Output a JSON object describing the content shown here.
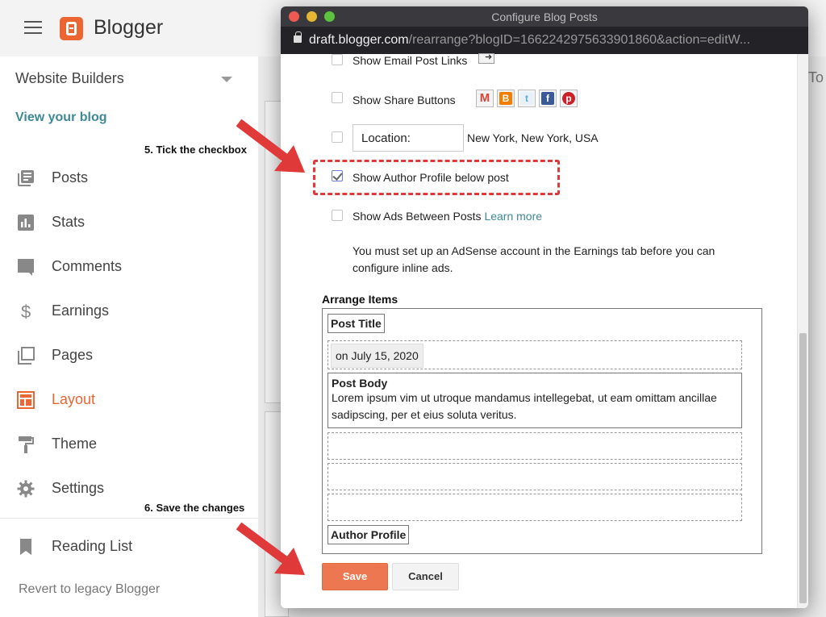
{
  "app": {
    "brand": "Blogger",
    "blog_selector": "Website Builders",
    "view_blog": "View your blog",
    "nav": [
      {
        "label": "Posts",
        "icon": "posts-icon",
        "active": false
      },
      {
        "label": "Stats",
        "icon": "stats-icon",
        "active": false
      },
      {
        "label": "Comments",
        "icon": "comments-icon",
        "active": false
      },
      {
        "label": "Earnings",
        "icon": "dollar-icon",
        "active": false
      },
      {
        "label": "Pages",
        "icon": "pages-icon",
        "active": false
      },
      {
        "label": "Layout",
        "icon": "layout-icon",
        "active": true
      },
      {
        "label": "Theme",
        "icon": "paint-roller-icon",
        "active": false
      },
      {
        "label": "Settings",
        "icon": "gear-icon",
        "active": false
      }
    ],
    "reading_list": "Reading List",
    "revert": "Revert to legacy Blogger",
    "partial_text": "To",
    "accent_color": "#ec6633"
  },
  "annotations": {
    "step5": "5. Tick the checkbox",
    "step6": "6. Save the changes",
    "arrow_color": "#e0393a"
  },
  "modal": {
    "title": "Configure Blog Posts",
    "url_host": "draft.blogger.com",
    "url_path": "/rearrange?blogID=1662242975633901860&action=editW...",
    "options": {
      "email_links": {
        "label": "Show Email Post Links",
        "checked": false
      },
      "share_buttons": {
        "label": "Show Share Buttons",
        "checked": false,
        "icons": [
          "gmail-icon",
          "blogger-icon",
          "twitter-icon",
          "facebook-icon",
          "pinterest-icon"
        ]
      },
      "location": {
        "label": "Location:",
        "value": "New York, New York, USA",
        "checked": false
      },
      "author_profile": {
        "label": "Show Author Profile below post",
        "checked": true
      },
      "ads_between": {
        "label": "Show Ads Between Posts",
        "link": "Learn more",
        "checked": false
      }
    },
    "adsense_note": "You must set up an AdSense account in the Earnings tab before you can configure inline ads.",
    "arrange": {
      "title": "Arrange Items",
      "post_title": "Post Title",
      "date": "on July 15, 2020",
      "post_body_heading": "Post Body",
      "post_body_text": "Lorem ipsum vim ut utroque mandamus intellegebat, ut eam omittam ancillae sadipscing, per et eius soluta veritus.",
      "author_profile": "Author Profile"
    },
    "buttons": {
      "save": "Save",
      "cancel": "Cancel"
    },
    "scroll_position": 0.5
  }
}
